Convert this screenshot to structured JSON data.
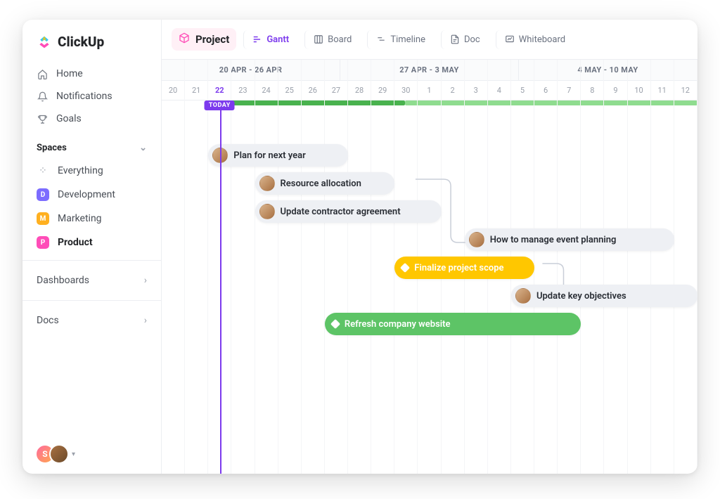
{
  "brand": {
    "name": "ClickUp"
  },
  "nav": {
    "home": "Home",
    "notifications": "Notifications",
    "goals": "Goals"
  },
  "spaces": {
    "header": "Spaces",
    "everything": "Everything",
    "items": [
      {
        "letter": "D",
        "label": "Development",
        "color": "#7c6cff"
      },
      {
        "letter": "M",
        "label": "Marketing",
        "color": "#ffb020"
      },
      {
        "letter": "P",
        "label": "Product",
        "color": "#ff4db8",
        "selected": true
      }
    ]
  },
  "sections": {
    "dashboards": "Dashboards",
    "docs": "Docs"
  },
  "user_avatar_initial": "S",
  "header": {
    "project_label": "Project",
    "views": {
      "gantt": "Gantt",
      "board": "Board",
      "timeline": "Timeline",
      "doc": "Doc",
      "whiteboard": "Whiteboard"
    }
  },
  "gantt": {
    "ranges": [
      "20 APR - 26 APR",
      "27 APR - 3 MAY",
      "4 MAY - 10 MAY"
    ],
    "days": [
      "20",
      "21",
      "22",
      "23",
      "24",
      "25",
      "26",
      "27",
      "28",
      "29",
      "30",
      "1",
      "2",
      "3",
      "4",
      "5",
      "6",
      "7",
      "8",
      "9",
      "10",
      "11",
      "12"
    ],
    "today_index": 2,
    "today_label": "TODAY",
    "tasks": [
      {
        "label": "Plan for next year",
        "kind": "grey",
        "avatar": true,
        "start_day_idx": 2,
        "span_days": 6,
        "row": 0
      },
      {
        "label": "Resource allocation",
        "kind": "grey",
        "avatar": true,
        "start_day_idx": 4,
        "span_days": 6,
        "row": 1
      },
      {
        "label": "Update contractor agreement",
        "kind": "grey",
        "avatar": true,
        "start_day_idx": 4,
        "span_days": 8,
        "row": 2
      },
      {
        "label": "How to manage event planning",
        "kind": "grey",
        "avatar": true,
        "start_day_idx": 13,
        "span_days": 9,
        "row": 3
      },
      {
        "label": "Finalize project scope",
        "kind": "yellow",
        "avatar": false,
        "start_day_idx": 10,
        "span_days": 6,
        "row": 4
      },
      {
        "label": "Update key objectives",
        "kind": "grey",
        "avatar": true,
        "start_day_idx": 15,
        "span_days": 8,
        "row": 5
      },
      {
        "label": "Refresh company website",
        "kind": "green",
        "avatar": false,
        "start_day_idx": 7,
        "span_days": 11,
        "row": 6
      }
    ]
  },
  "colors": {
    "accent_purple": "#7c3aed",
    "green": "#5dc466",
    "yellow": "#ffc700",
    "pink": "#ff4db8"
  }
}
